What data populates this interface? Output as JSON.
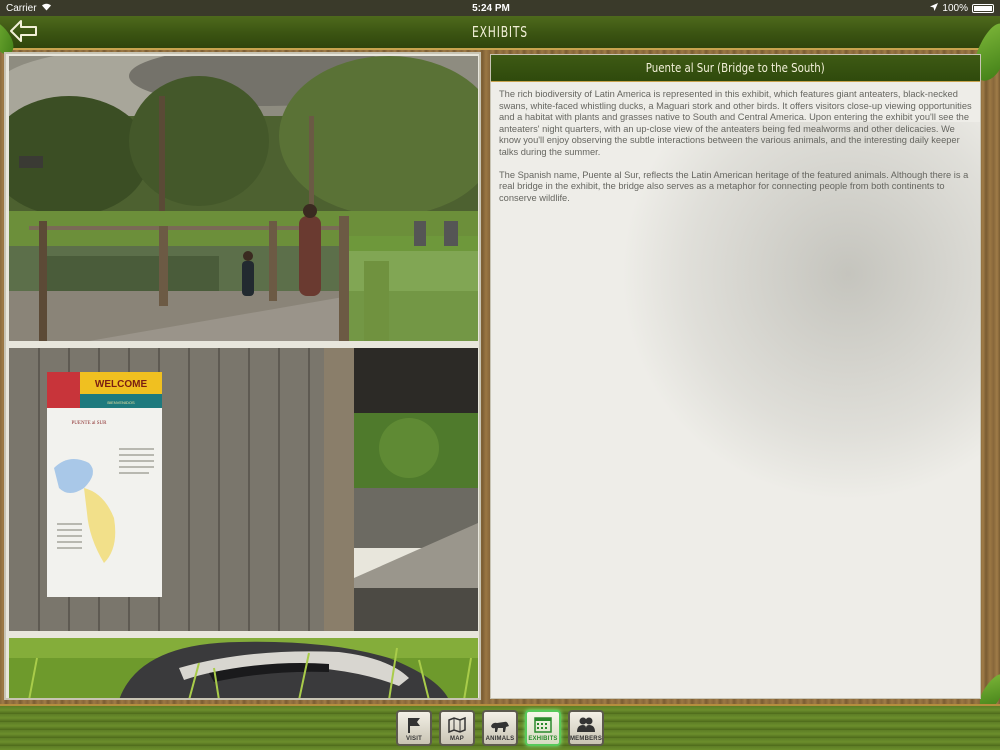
{
  "status_bar": {
    "carrier": "Carrier",
    "time": "5:24 PM",
    "battery": "100%"
  },
  "header": {
    "title": "EXHIBITS",
    "back_icon": "back-arrow-icon"
  },
  "exhibit": {
    "title": "Puente al Sur (Bridge to the South)",
    "paragraphs": [
      "The rich biodiversity of Latin America is represented in this exhibit, which features giant anteaters, black-necked swans, white-faced whistling ducks, a Maguari stork and other birds. It offers visitors close-up viewing opportunities and a habitat with plants and grasses native to South and Central America. Upon entering the exhibit you'll see the anteaters' night quarters, with an up-close view of the anteaters being fed mealworms and other delicacies. We know you'll enjoy observing the subtle interactions between the various animals, and the interesting daily keeper talks during the summer.",
      "The Spanish name, Puente al Sur, reflects the Latin American heritage of the featured animals. Although there is a real bridge in the exhibit, the bridge also serves as a metaphor for connecting people from both continents to conserve wildlife."
    ],
    "photos": [
      {
        "subject": "bridge-pond-photo"
      },
      {
        "subject": "welcome-sign-photo"
      },
      {
        "subject": "anteater-photo"
      }
    ],
    "sign_text": {
      "welcome": "WELCOME",
      "bienvenidos": "BIENVENIDOS",
      "name": "PUENTE al SUR"
    }
  },
  "tab_bar": {
    "items": [
      {
        "label": "VISIT",
        "icon": "flag-icon",
        "active": false
      },
      {
        "label": "MAP",
        "icon": "map-icon",
        "active": false
      },
      {
        "label": "ANIMALS",
        "icon": "panther-icon",
        "active": false
      },
      {
        "label": "EXHIBITS",
        "icon": "calendar-icon",
        "active": true
      },
      {
        "label": "MEMBERS",
        "icon": "people-icon",
        "active": false
      }
    ]
  },
  "colors": {
    "header_green": "#3b5412",
    "accent_gold": "#c9a44f",
    "active_green": "#58c95a"
  }
}
